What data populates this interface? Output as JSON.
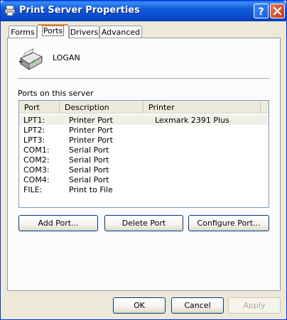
{
  "window": {
    "title": "Print Server Properties"
  },
  "tabs": [
    {
      "label": "Forms",
      "active": false
    },
    {
      "label": "Ports",
      "active": true
    },
    {
      "label": "Drivers",
      "active": false
    },
    {
      "label": "Advanced",
      "active": false
    }
  ],
  "server": {
    "name": "LOGAN",
    "icon": "printer-server-icon"
  },
  "ports_list": {
    "label": "Ports on this server",
    "columns": [
      "Port",
      "Description",
      "Printer"
    ],
    "rows": [
      {
        "port": "LPT1:",
        "description": "Printer Port",
        "printer": "Lexmark 2391 Plus",
        "selected": true
      },
      {
        "port": "LPT2:",
        "description": "Printer Port",
        "printer": ""
      },
      {
        "port": "LPT3:",
        "description": "Printer Port",
        "printer": ""
      },
      {
        "port": "COM1:",
        "description": "Serial Port",
        "printer": ""
      },
      {
        "port": "COM2:",
        "description": "Serial Port",
        "printer": ""
      },
      {
        "port": "COM3:",
        "description": "Serial Port",
        "printer": ""
      },
      {
        "port": "COM4:",
        "description": "Serial Port",
        "printer": ""
      },
      {
        "port": "FILE:",
        "description": "Print to File",
        "printer": ""
      }
    ]
  },
  "actions": {
    "add_port": "Add Port...",
    "delete_port": "Delete Port",
    "configure_port": "Configure Port..."
  },
  "dialog_buttons": {
    "ok": "OK",
    "cancel": "Cancel",
    "apply": "Apply",
    "apply_enabled": false
  },
  "colors": {
    "titlebar": "#0a5ee8",
    "active_tab_accent": "#e68b2c",
    "dialog_bg": "#ece9d8"
  }
}
